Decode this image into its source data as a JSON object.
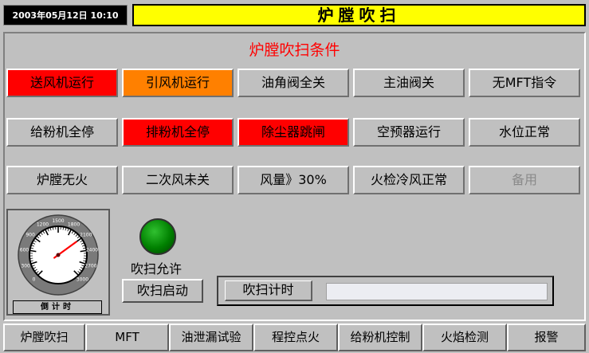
{
  "header": {
    "datetime": "2003年05月12日   10:10",
    "title": "炉膛吹扫"
  },
  "conditions": {
    "title": "炉膛吹扫条件",
    "rows": [
      [
        {
          "label": "送风机运行",
          "state": "red"
        },
        {
          "label": "引风机运行",
          "state": "orange"
        },
        {
          "label": "油角阀全关",
          "state": "normal"
        },
        {
          "label": "主油阀关",
          "state": "normal"
        },
        {
          "label": "无MFT指令",
          "state": "normal"
        }
      ],
      [
        {
          "label": "给粉机全停",
          "state": "normal"
        },
        {
          "label": "排粉机全停",
          "state": "red"
        },
        {
          "label": "除尘器跳闸",
          "state": "red"
        },
        {
          "label": "空预器运行",
          "state": "normal"
        },
        {
          "label": "水位正常",
          "state": "normal"
        }
      ],
      [
        {
          "label": "炉膛无火",
          "state": "normal"
        },
        {
          "label": "二次风未关",
          "state": "normal"
        },
        {
          "label": "风量》30%",
          "state": "normal"
        },
        {
          "label": "火检冷风正常",
          "state": "normal"
        },
        {
          "label": "备用",
          "state": "disabled"
        }
      ]
    ]
  },
  "gauge": {
    "label": "倒计时",
    "ticks": [
      "0",
      "300",
      "600",
      "900",
      "1200",
      "1500",
      "1800",
      "2100",
      "2400",
      "2700",
      "3000"
    ],
    "min": 0,
    "max": 3000,
    "value": 2100
  },
  "purge": {
    "allow_label": "吹扫允许",
    "allow_color": "#00a000",
    "start_label": "吹扫启动",
    "timer_label": "吹扫计时"
  },
  "nav": [
    "炉膛吹扫",
    "MFT",
    "油泄漏试验",
    "程控点火",
    "给粉机控制",
    "火焰检测",
    "报警"
  ],
  "colors": {
    "red": "#ff0000",
    "orange": "#ff8000",
    "title_bar": "#ffff00"
  }
}
